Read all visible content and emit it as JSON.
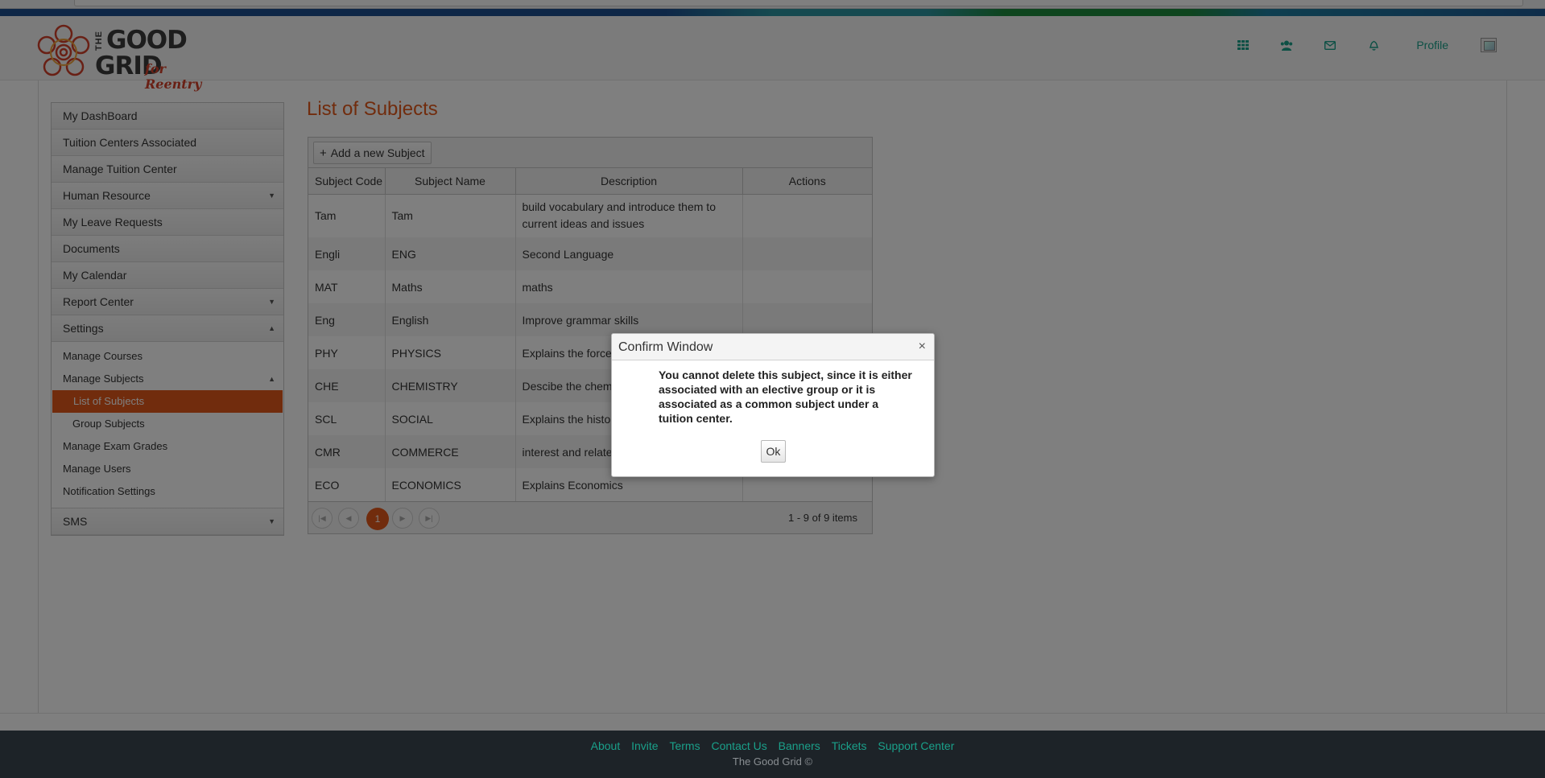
{
  "header": {
    "logo": {
      "the": "THE",
      "good": "GOOD",
      "grid": "GRID",
      "tagline": "for Reentry"
    },
    "nav_icons": [
      "apps-grid-icon",
      "users-icon",
      "mail-icon",
      "bell-icon"
    ],
    "profile_label": "Profile"
  },
  "sidebar": {
    "items": [
      {
        "label": "My DashBoard"
      },
      {
        "label": "Tuition Centers Associated"
      },
      {
        "label": "Manage Tuition Center"
      },
      {
        "label": "Human Resource",
        "caret": "▼"
      },
      {
        "label": "My Leave Requests"
      },
      {
        "label": "Documents"
      },
      {
        "label": "My Calendar"
      },
      {
        "label": "Report Center",
        "caret": "▼"
      },
      {
        "label": "Settings",
        "caret": "▲"
      }
    ],
    "settings_sub": {
      "manage_courses": "Manage Courses",
      "manage_subjects": "Manage Subjects",
      "manage_subjects_caret": "▲",
      "list_of_subjects": "List of Subjects",
      "group_subjects": "Group Subjects",
      "manage_exam_grades": "Manage Exam Grades",
      "manage_users": "Manage Users",
      "notification_settings": "Notification Settings"
    },
    "sms": {
      "label": "SMS",
      "caret": "▼"
    }
  },
  "main": {
    "title": "List of Subjects",
    "add_button": "Add a new Subject",
    "columns": [
      "Subject Code",
      "Subject Name",
      "Description",
      "Actions"
    ],
    "rows": [
      {
        "code": "Tam",
        "name": "Tam",
        "description": "build vocabulary and introduce them to current ideas and issues"
      },
      {
        "code": "Engli",
        "name": "ENG",
        "description": "Second Language"
      },
      {
        "code": "MAT",
        "name": "Maths",
        "description": "maths"
      },
      {
        "code": "Eng",
        "name": "English",
        "description": "Improve grammar skills"
      },
      {
        "code": "PHY",
        "name": "PHYSICS",
        "description": "Explains the force,"
      },
      {
        "code": "CHE",
        "name": "CHEMISTRY",
        "description": "Descibe the chemic"
      },
      {
        "code": "SCL",
        "name": "SOCIAL",
        "description": "Explains the history"
      },
      {
        "code": "CMR",
        "name": "COMMERCE",
        "description": "interest and related"
      },
      {
        "code": "ECO",
        "name": "ECONOMICS",
        "description": "Explains Economics"
      }
    ],
    "pager": {
      "current_page": "1",
      "info": "1 - 9 of 9 items",
      "first": "|◀",
      "prev": "◀",
      "next": "▶",
      "last": "▶|"
    }
  },
  "modal": {
    "title": "Confirm Window",
    "close": "×",
    "message": "You cannot delete this subject, since it is either associated with an elective group or it is associated as a common subject under a tuition center.",
    "ok_label": "Ok"
  },
  "footer": {
    "links": [
      "About",
      "Invite",
      "Terms",
      "Contact Us",
      "Banners",
      "Tickets",
      "Support Center"
    ],
    "copyright": "The Good Grid ©"
  },
  "colors": {
    "accent_orange": "#e2581a",
    "link_teal": "#1aa08a",
    "footer_bg": "#1d2328"
  }
}
